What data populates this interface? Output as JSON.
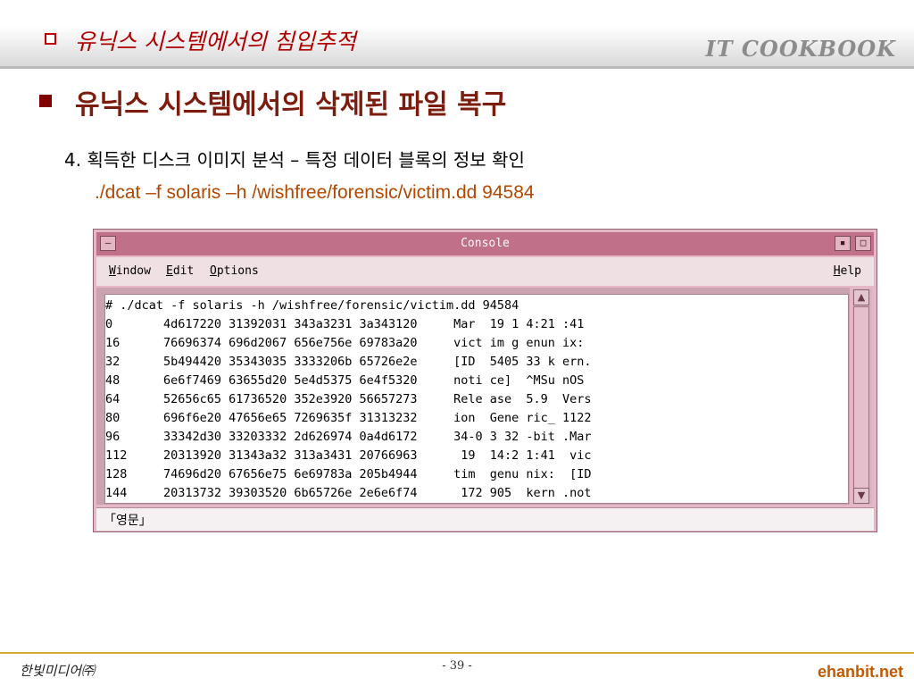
{
  "slide": {
    "header_title": "유닉스 시스템에서의 침입추적",
    "brand": "IT COOKBOOK",
    "heading": "유닉스 시스템에서의 삭제된 파일 복구",
    "step_text": "4. 획득한 디스크 이미지 분석 –  특정 데이터 블록의 정보 확인",
    "command": "./dcat –f solaris –h /wishfree/forensic/victim.dd 94584"
  },
  "console": {
    "title": "Console",
    "menu": {
      "window": {
        "key": "W",
        "rest": "indow"
      },
      "edit": {
        "key": "E",
        "rest": "dit"
      },
      "options": {
        "key": "O",
        "rest": "ptions"
      },
      "help": {
        "key": "H",
        "rest": "elp"
      }
    },
    "lines": [
      "# ./dcat -f solaris -h /wishfree/forensic/victim.dd 94584",
      "0       4d617220 31392031 343a3231 3a343120     Mar  19 1 4:21 :41",
      "16      76696374 696d2067 656e756e 69783a20     vict im g enun ix:",
      "32      5b494420 35343035 3333206b 65726e2e     [ID  5405 33 k ern.",
      "48      6e6f7469 63655d20 5e4d5375 6e4f5320     noti ce]  ^MSu nOS",
      "64      52656c65 61736520 352e3920 56657273     Rele ase  5.9  Vers",
      "80      696f6e20 47656e65 7269635f 31313232     ion  Gene ric_ 1122",
      "96      33342d30 33203332 2d626974 0a4d6172     34-0 3 32 -bit .Mar",
      "112     20313920 31343a32 313a3431 20766963      19  14:2 1:41  vic",
      "128     74696d20 67656e75 6e69783a 205b4944     tim  genu nix:  [ID",
      "144     20313732 39303520 6b65726e 2e6e6f74      172 905  kern .not"
    ],
    "status": "「영문」"
  },
  "footer": {
    "publisher": "한빛미디어㈜",
    "page": "- 39 -",
    "site": "ehanbit.net"
  }
}
